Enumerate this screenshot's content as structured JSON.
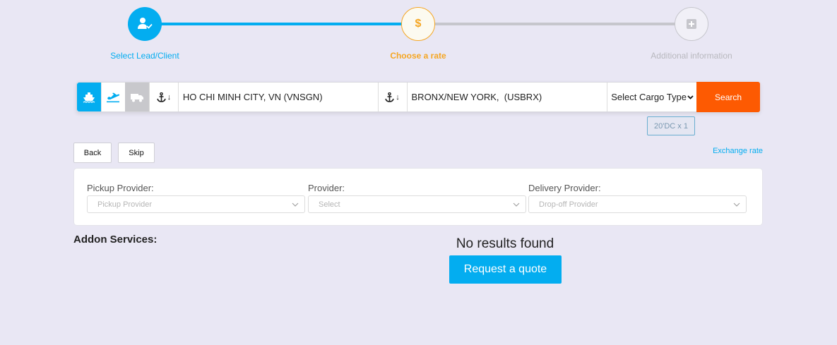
{
  "colors": {
    "accent": "#03adf0",
    "active_step": "#f5a623",
    "inactive": "#c6c6cc",
    "inactive_text": "#b8b8be",
    "search": "#fd5a02",
    "truck_bg": "#c8c8cc",
    "badge": "#6aaed0"
  },
  "stepper": {
    "steps": [
      {
        "label": "Select Lead/Client",
        "state": "completed",
        "icon": "user-check-icon"
      },
      {
        "label": "Choose a rate",
        "state": "active",
        "icon_text": "$"
      },
      {
        "label": "Additional information",
        "state": "pending",
        "icon": "plus-square-icon"
      }
    ]
  },
  "search": {
    "modes": [
      {
        "name": "sea",
        "icon": "ship-icon",
        "selected": true
      },
      {
        "name": "air",
        "icon": "plane-icon",
        "selected": false
      },
      {
        "name": "truck",
        "icon": "truck-icon",
        "selected": false
      }
    ],
    "origin": {
      "value": "HO CHI MINH CITY, VN (VNSGN)",
      "icon": "anchor-icon"
    },
    "destination": {
      "value": "BRONX/NEW YORK,  (USBRX)",
      "icon": "anchor-icon"
    },
    "cargo_type": {
      "selected": "Select Cargo Type"
    },
    "search_label": "Search"
  },
  "container_badge": "20'DC x 1",
  "nav": {
    "back_label": "Back",
    "skip_label": "Skip",
    "exchange_rate_label": "Exchange rate"
  },
  "providers": {
    "pickup": {
      "label": "Pickup Provider:",
      "placeholder": "Pickup Provider"
    },
    "provider": {
      "label": "Provider:",
      "placeholder": "Select"
    },
    "delivery": {
      "label": "Delivery Provider:",
      "placeholder": "Drop-off Provider"
    }
  },
  "addon": {
    "title": "Addon Services:",
    "no_results": "No results found",
    "request_quote_label": "Request a quote"
  }
}
